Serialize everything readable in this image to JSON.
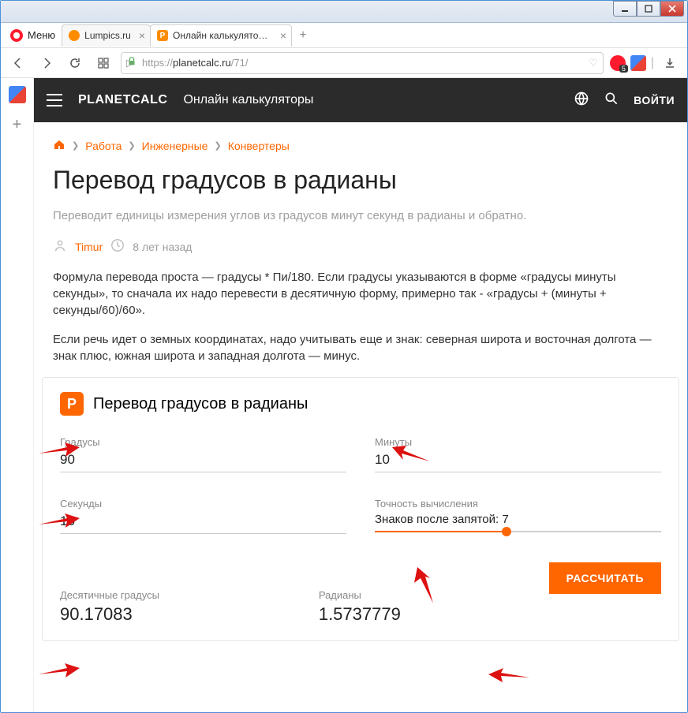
{
  "window": {
    "menu": "Меню"
  },
  "tabs": [
    {
      "title": "Lumpics.ru"
    },
    {
      "title": "Онлайн калькулятор: Пер"
    }
  ],
  "url": {
    "scheme": "https://",
    "host": "planetcalc.ru",
    "path": "/71/"
  },
  "site": {
    "brand": "PLANETCALC",
    "tagline": "Онлайн калькуляторы",
    "login": "ВОЙТИ"
  },
  "breadcrumbs": {
    "items": [
      "Работа",
      "Инженерные",
      "Конвертеры"
    ]
  },
  "page": {
    "title": "Перевод градусов в радианы",
    "subtitle": "Переводит единицы измерения углов из градусов минут секунд в радианы и обратно.",
    "author": "Timur",
    "ago": "8 лет назад",
    "desc1": "Формула перевода проста — градусы * Пи/180. Если градусы указываются в форме «градусы минуты секунды», то сначала их надо перевести в десятичную форму, примерно так - «градусы + (минуты + секунды/60)/60».",
    "desc2": "Если речь идет о земных координатах, надо учитывать еще и знак: северная широта и восточная долгота — знак плюс, южная широта и западная долгота — минус."
  },
  "calc": {
    "title": "Перевод градусов в радианы",
    "fields": {
      "degrees": {
        "label": "Градусы",
        "value": "90"
      },
      "minutes": {
        "label": "Минуты",
        "value": "10"
      },
      "seconds": {
        "label": "Секунды",
        "value": "15"
      },
      "precision": {
        "label": "Точность вычисления",
        "text": "Знаков после запятой: 7"
      }
    },
    "button": "РАССЧИТАТЬ",
    "results": {
      "decimal_deg": {
        "label": "Десятичные градусы",
        "value": "90.17083"
      },
      "radians": {
        "label": "Радианы",
        "value": "1.5737779"
      }
    }
  }
}
